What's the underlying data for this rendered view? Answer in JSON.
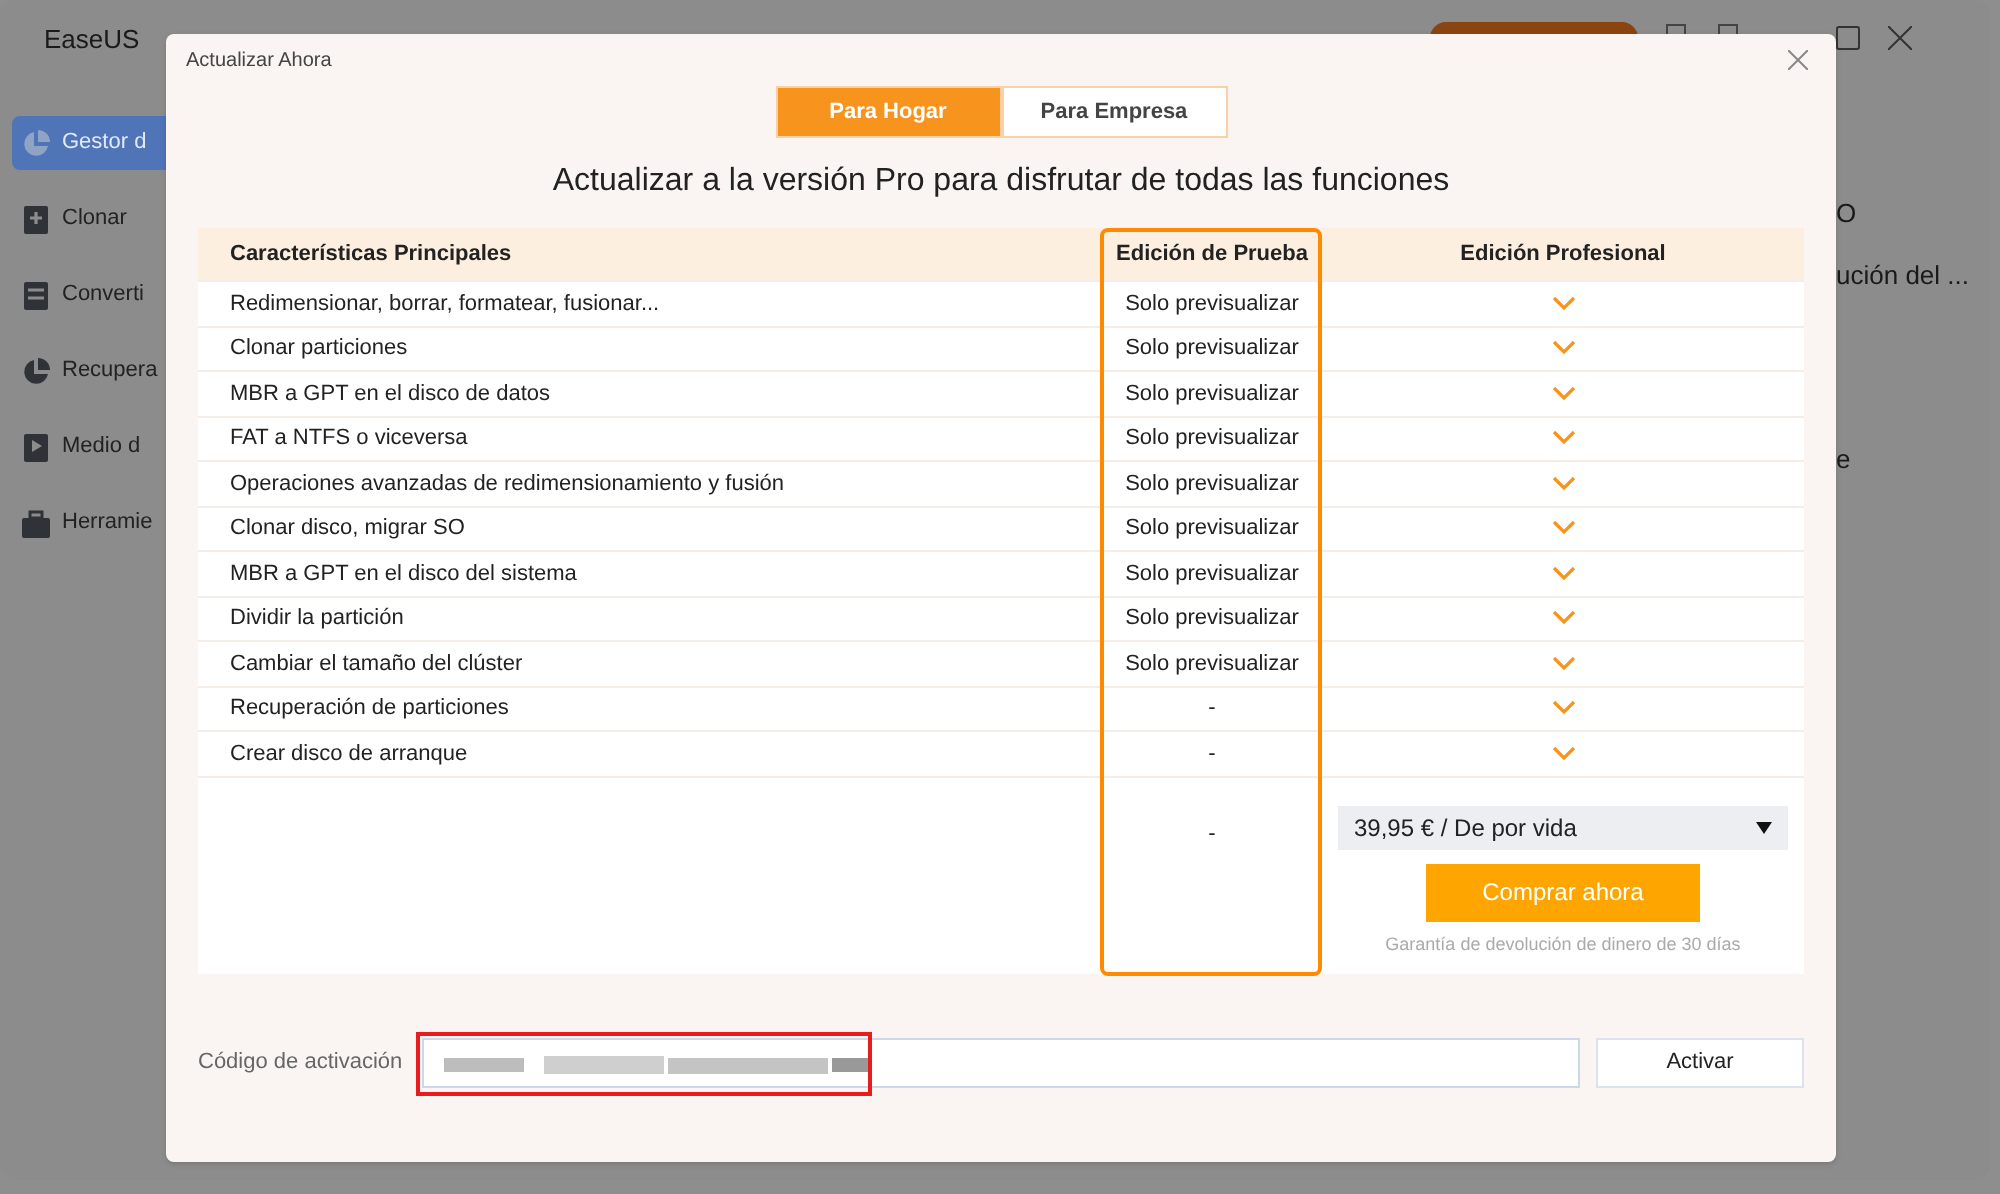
{
  "app": {
    "title": "EaseUS",
    "sidebar": [
      {
        "label": "Gestor d",
        "selected": true
      },
      {
        "label": "Clonar",
        "selected": false
      },
      {
        "label": "Converti",
        "selected": false
      },
      {
        "label": "Recupera",
        "selected": false
      },
      {
        "label": "Medio d",
        "selected": false
      },
      {
        "label": "Herramie",
        "selected": false
      }
    ],
    "right_texts": [
      "O",
      "ución del ...",
      "e"
    ]
  },
  "dialog": {
    "title": "Actualizar Ahora",
    "tabs": [
      {
        "label": "Para Hogar",
        "selected": true
      },
      {
        "label": "Para Empresa",
        "selected": false
      }
    ],
    "heading": "Actualizar a la versión Pro para disfrutar de todas las funciones",
    "columns": [
      "Características Principales",
      "Edición de Prueba",
      "Edición Profesional"
    ],
    "rows": [
      {
        "feature": "Redimensionar, borrar, formatear, fusionar...",
        "trial": "Solo previsualizar",
        "pro_included": true
      },
      {
        "feature": "Clonar particiones",
        "trial": "Solo previsualizar",
        "pro_included": true
      },
      {
        "feature": "MBR a GPT en el disco de datos",
        "trial": "Solo previsualizar",
        "pro_included": true
      },
      {
        "feature": "FAT a NTFS o viceversa",
        "trial": "Solo previsualizar",
        "pro_included": true
      },
      {
        "feature": "Operaciones avanzadas de redimensionamiento y fusión",
        "trial": "Solo previsualizar",
        "pro_included": true
      },
      {
        "feature": "Clonar disco, migrar SO",
        "trial": "Solo previsualizar",
        "pro_included": true
      },
      {
        "feature": "MBR a GPT en el disco del sistema",
        "trial": "Solo previsualizar",
        "pro_included": true
      },
      {
        "feature": "Dividir la partición",
        "trial": "Solo previsualizar",
        "pro_included": true
      },
      {
        "feature": "Cambiar el tamaño del clúster",
        "trial": "Solo previsualizar",
        "pro_included": true
      },
      {
        "feature": "Recuperación de particiones",
        "trial": "-",
        "pro_included": true
      },
      {
        "feature": "Crear disco de arranque",
        "trial": "-",
        "pro_included": true
      }
    ],
    "footer": {
      "trial": "-",
      "price": "39,95 € / De por vida",
      "buy_button": "Comprar ahora",
      "guarantee": "Garantía de devolución de dinero de 30 días"
    },
    "activation": {
      "label": "Código de activación",
      "button": "Activar"
    }
  }
}
